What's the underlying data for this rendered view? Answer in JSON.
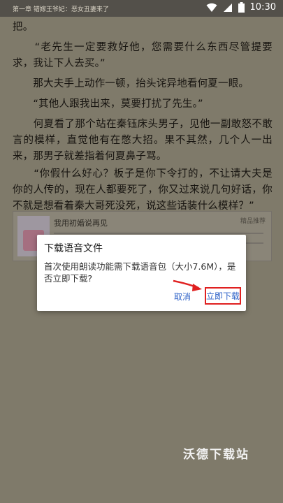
{
  "status_bar": {
    "chapter_title": "第一章 错嫁王爷妃：恶女丑妻来了",
    "time": "10:30"
  },
  "content": {
    "paragraphs": [
      "把。",
      "　　“老先生一定要救好他，您需要什么东西尽管提要求，我让下人去买。”",
      "　　那大夫手上动作一顿，抬头诧异地看何夏一眼。",
      "　　“其他人跟我出来，莫要打扰了先生。”",
      "　　何夏看了那个站在秦钰床头男子，见他一副敢怒不敢言的模样，直觉他有在憋大招。果不其然，几个人一出来，那男子就差指着何夏鼻子骂。",
      "　　“你假什么好心？板子是你下令打的，不让请大夫是你的人传的，现在人都要死了，你又过来说几句好话，你不就是想看着秦大哥死没死，说这些话装什么模样？”"
    ]
  },
  "ad_card": {
    "title": "我用初婚说再见",
    "tag": "精品推荐"
  },
  "dialog": {
    "title": "下载语音文件",
    "message": "首次使用朗读功能需下载语音包（大小7.6M），是否立即下载?",
    "cancel_label": "取消",
    "confirm_label": "立即下载"
  },
  "watermark": "沃德下载站",
  "colors": {
    "page_bg": "#7f7a6a",
    "dialog_button_text": "#2f63c8",
    "highlight_red": "#e02020"
  }
}
